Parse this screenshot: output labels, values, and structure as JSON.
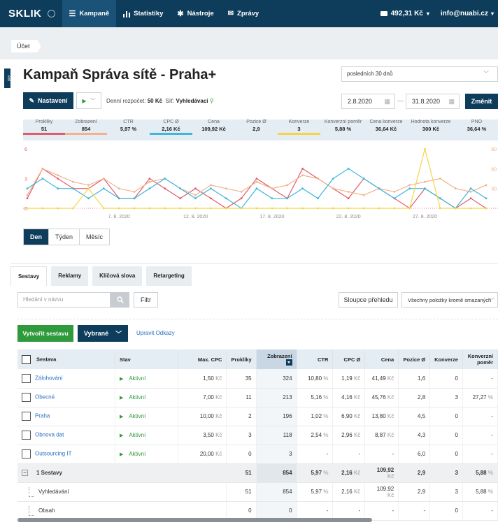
{
  "nav": {
    "logo": "SKLIK",
    "items": [
      {
        "label": "Kampaně",
        "icon": "list-icon",
        "active": true
      },
      {
        "label": "Statistiky",
        "icon": "bar-chart-icon",
        "active": false
      },
      {
        "label": "Nástroje",
        "icon": "gear-icon",
        "active": false
      },
      {
        "label": "Zprávy",
        "icon": "mail-icon",
        "active": false
      }
    ],
    "credit": "492,31 Kč",
    "user": "info@nuabi.cz"
  },
  "breadcrumb": "Účet",
  "sidetab": "ext",
  "page_title": "Kampaň Správa sítě - Praha+",
  "period": "posledních 30 dnů",
  "buttons": {
    "settings": "Nastavení",
    "change": "Změnit",
    "create": "Vytvořit sestavu",
    "selected": "Vybrané",
    "filter": "Filtr",
    "columns": "Sloupce přehledu"
  },
  "info": {
    "budget_label": "Denní rozpočet:",
    "budget_value": "50 Kč",
    "network_label": "Síť:",
    "network_value": "Vyhledávací"
  },
  "dates": {
    "from": "2.8.2020",
    "to": "31.8.2020",
    "sep": "—"
  },
  "metrics": [
    {
      "label": "Prokliky",
      "value": "51",
      "color": "#e05c6b"
    },
    {
      "label": "Zobrazení",
      "value": "854",
      "color": "#f3b28a"
    },
    {
      "label": "CTR",
      "value": "5,97 %",
      "color": ""
    },
    {
      "label": "CPC Ø",
      "value": "2,16 Kč",
      "color": "#3fb6dc"
    },
    {
      "label": "Cena",
      "value": "109,92 Kč",
      "color": ""
    },
    {
      "label": "Pozice Ø",
      "value": "2,9",
      "color": ""
    },
    {
      "label": "Konverze",
      "value": "3",
      "color": "#f5d547"
    },
    {
      "label": "Konverzní poměr",
      "value": "5,88 %",
      "color": ""
    },
    {
      "label": "Cena konverze",
      "value": "36,64 Kč",
      "color": ""
    },
    {
      "label": "Hodnota konverze",
      "value": "300 Kč",
      "color": ""
    },
    {
      "label": "PNO",
      "value": "36,64 %",
      "color": ""
    }
  ],
  "chart_data": {
    "type": "line",
    "x": [
      "1.8",
      "2.8",
      "3.8",
      "4.8",
      "5.8",
      "6.8",
      "7.8",
      "8.8",
      "9.8",
      "10.8",
      "11.8",
      "12.8",
      "13.8",
      "14.8",
      "15.8",
      "16.8",
      "17.8",
      "18.8",
      "19.8",
      "20.8",
      "21.8",
      "22.8",
      "23.8",
      "24.8",
      "25.8",
      "26.8",
      "27.8",
      "28.8",
      "29.8",
      "30.8",
      "31.8"
    ],
    "xticks": [
      "7. 8. 2020",
      "12. 8. 2020",
      "17. 8. 2020",
      "22. 8. 2020",
      "27. 8. 2020"
    ],
    "yticks_left": [
      "6",
      "3",
      "0"
    ],
    "yticks_right": [
      "90",
      "60",
      "30"
    ],
    "ylim_left": [
      0,
      6
    ],
    "ylim_right": [
      0,
      90
    ],
    "series": [
      {
        "color": "#e05c6b",
        "axis": "left",
        "values": [
          1,
          4,
          3,
          2,
          2,
          3,
          1,
          1,
          3,
          2,
          1,
          2,
          1,
          0,
          1,
          3,
          2,
          1,
          4,
          3,
          2,
          1,
          3,
          2,
          1,
          0,
          2,
          1,
          0,
          1,
          0
        ]
      },
      {
        "color": "#f3b28a",
        "axis": "right",
        "values": [
          20,
          60,
          50,
          40,
          35,
          45,
          30,
          25,
          40,
          45,
          30,
          20,
          35,
          30,
          25,
          40,
          30,
          35,
          50,
          45,
          30,
          25,
          20,
          30,
          25,
          35,
          40,
          45,
          30,
          25,
          35
        ]
      },
      {
        "color": "#3fb6dc",
        "axis": "left",
        "values": [
          2,
          3,
          2,
          2,
          1,
          2,
          1,
          1,
          2,
          3,
          2,
          1,
          2,
          1,
          0,
          2,
          1,
          1,
          2,
          1,
          3,
          4,
          3,
          2,
          1,
          2,
          2,
          1,
          0,
          2,
          1
        ]
      },
      {
        "color": "#f5d547",
        "axis": "left",
        "values": [
          0,
          0,
          0,
          0,
          2,
          0,
          0,
          0,
          0,
          0,
          0,
          0,
          0,
          0,
          0,
          0,
          0,
          0,
          0,
          0,
          0,
          0,
          0,
          0,
          0,
          0,
          6,
          0,
          0,
          0,
          0
        ]
      }
    ]
  },
  "period_tabs": [
    {
      "label": "Den",
      "active": true
    },
    {
      "label": "Týden",
      "active": false
    },
    {
      "label": "Měsíc",
      "active": false
    }
  ],
  "subtabs": [
    {
      "label": "Sestavy",
      "active": true
    },
    {
      "label": "Reklamy",
      "active": false
    },
    {
      "label": "Klíčová slova",
      "active": false
    },
    {
      "label": "Retargeting",
      "active": false
    }
  ],
  "search_placeholder": "Hledání v názvu",
  "filter_select": "Všechny položky kromě smazaných",
  "edit_links": "Upravit Odkazy",
  "table": {
    "headers": [
      "Sestava",
      "Stav",
      "Max. CPC",
      "Prokliky",
      "Zobrazení",
      "CTR",
      "CPC Ø",
      "Cena",
      "Pozice Ø",
      "Konverze",
      "Konverzní poměr"
    ],
    "rows": [
      {
        "name": "Zálohování",
        "status": "Aktivní",
        "maxcpc": "1,50",
        "clicks": "35",
        "imps": "324",
        "ctr": "10,80",
        "cpc": "1,19",
        "cost": "41,49",
        "pos": "1,6",
        "conv": "0",
        "rate": "-"
      },
      {
        "name": "Obecné",
        "status": "Aktivní",
        "maxcpc": "7,00",
        "clicks": "11",
        "imps": "213",
        "ctr": "5,16",
        "cpc": "4,16",
        "cost": "45,76",
        "pos": "2,8",
        "conv": "3",
        "rate": "27,27"
      },
      {
        "name": "Praha",
        "status": "Aktivní",
        "maxcpc": "10,00",
        "clicks": "2",
        "imps": "196",
        "ctr": "1,02",
        "cpc": "6,90",
        "cost": "13,80",
        "pos": "4,5",
        "conv": "0",
        "rate": "-"
      },
      {
        "name": "Obnova dat",
        "status": "Aktivní",
        "maxcpc": "3,50",
        "clicks": "3",
        "imps": "118",
        "ctr": "2,54",
        "cpc": "2,96",
        "cost": "8,87",
        "pos": "4,3",
        "conv": "0",
        "rate": "-"
      },
      {
        "name": "Outsourcing IT",
        "status": "Aktivní",
        "maxcpc": "20,00",
        "clicks": "0",
        "imps": "3",
        "ctr": "-",
        "cpc": "-",
        "cost": "-",
        "pos": "6,0",
        "conv": "0",
        "rate": "-"
      }
    ],
    "total": {
      "name": "1 Sestavy",
      "clicks": "51",
      "imps": "854",
      "ctr": "5,97",
      "cpc": "2,16",
      "cost": "109,92",
      "pos": "2,9",
      "conv": "3",
      "rate": "5,88"
    },
    "sub": [
      {
        "name": "Vyhledávání",
        "clicks": "51",
        "imps": "854",
        "ctr": "5,97",
        "cpc": "2,16",
        "cost": "109,92",
        "pos": "2,9",
        "conv": "3",
        "rate": "5,88"
      },
      {
        "name": "Obsah",
        "clicks": "0",
        "imps": "0",
        "ctr": "-",
        "cpc": "-",
        "cost": "-",
        "pos": "-",
        "conv": "0",
        "rate": "-"
      }
    ],
    "unit_kc": "Kč",
    "unit_pct": "%"
  }
}
